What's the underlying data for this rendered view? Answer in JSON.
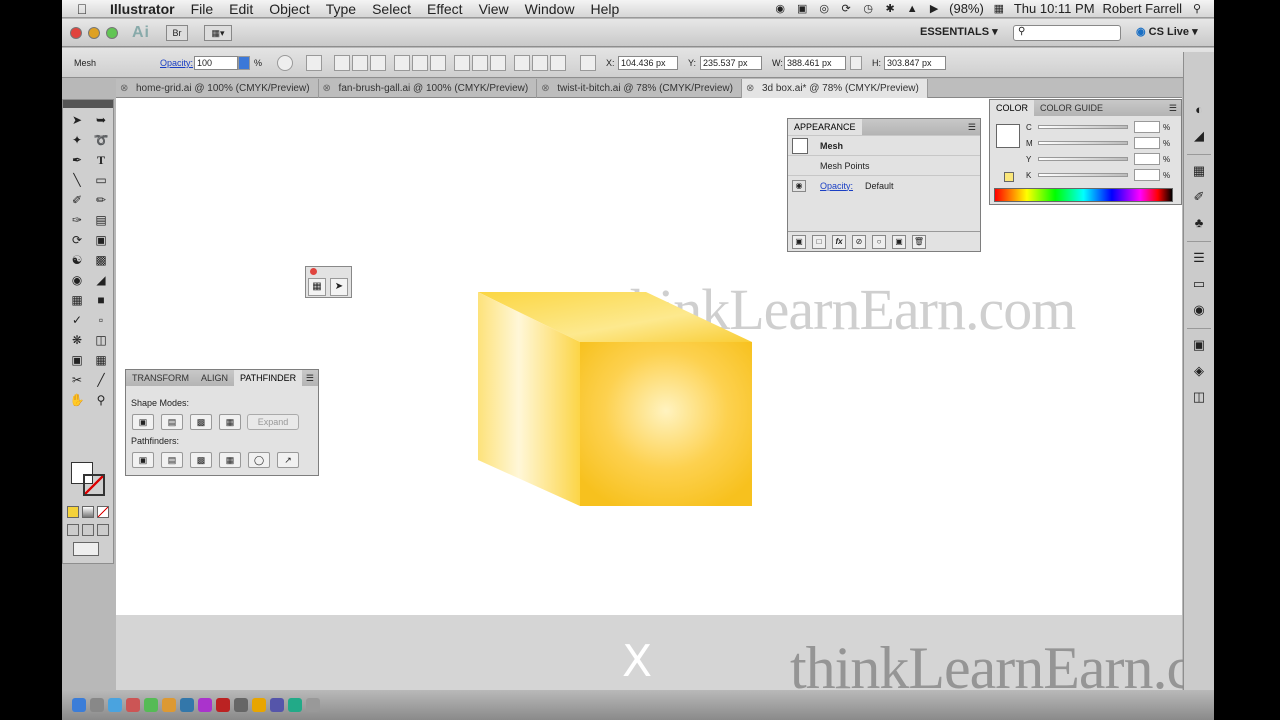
{
  "menubar": {
    "apple": "",
    "items": [
      "Illustrator",
      "File",
      "Edit",
      "Object",
      "Type",
      "Select",
      "Effect",
      "View",
      "Window",
      "Help"
    ],
    "battery": "(98%)",
    "clock": "Thu 10:11 PM",
    "user": "Robert Farrell"
  },
  "appbar": {
    "logo": "Ai",
    "bridge": "Br",
    "workspace": "ESSENTIALS ▾",
    "search_placeholder": "",
    "cs_live": "CS Live ▾"
  },
  "control_bar": {
    "selection": "Mesh",
    "opacity_label": "Opacity:",
    "opacity_value": "100",
    "opacity_unit": "%",
    "x_label": "X:",
    "x_value": "104.436 px",
    "y_label": "Y:",
    "y_value": "235.537 px",
    "w_label": "W:",
    "w_value": "388.461 px",
    "h_label": "H:",
    "h_value": "303.847 px"
  },
  "tabs": [
    {
      "label": "home-grid.ai @ 100% (CMYK/Preview)",
      "active": false
    },
    {
      "label": "fan-brush-gall.ai @ 100% (CMYK/Preview)",
      "active": false
    },
    {
      "label": "twist-it-bitch.ai @ 78% (CMYK/Preview)",
      "active": false
    },
    {
      "label": "3d box.ai* @ 78% (CMYK/Preview)",
      "active": true
    }
  ],
  "appearance_panel": {
    "title": "APPEARANCE",
    "rows": [
      {
        "label": "Mesh"
      },
      {
        "label": "Mesh Points"
      },
      {
        "label": "Opacity:",
        "value": "Default"
      }
    ]
  },
  "color_panel": {
    "tabs": [
      "COLOR",
      "COLOR GUIDE"
    ],
    "channels": [
      "C",
      "M",
      "Y",
      "K"
    ],
    "unit": "%"
  },
  "pathfinder_panel": {
    "tabs": [
      "TRANSFORM",
      "ALIGN",
      "PATHFINDER"
    ],
    "shape_modes_label": "Shape Modes:",
    "expand_label": "Expand",
    "pathfinders_label": "Pathfinders:"
  },
  "canvas": {
    "watermark": "thinkLearnEarn.com",
    "overlay_watermark": "thinkLearnEarn.com",
    "close_glyph": "X",
    "box_colors": {
      "top": "#fbd94a",
      "front_center": "#fff3c0",
      "front_edge": "#f7c11e",
      "side": "#fde27a"
    }
  }
}
